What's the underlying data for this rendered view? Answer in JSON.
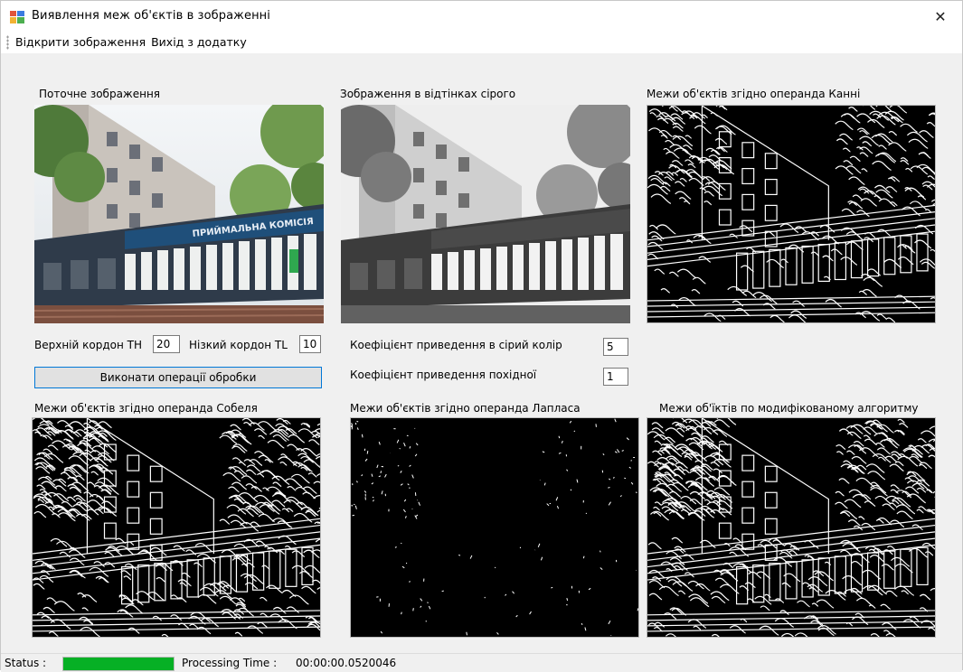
{
  "window": {
    "title": "Виявлення меж об'єктів в зображенні",
    "close_symbol": "✕"
  },
  "menu": {
    "items": [
      "Відкрити зображення",
      "Вихід з додатку"
    ]
  },
  "panels": {
    "current_label": "Поточне зображення",
    "gray_label": "Зображення в відтінках сірого",
    "canny_label": "Межи об'єктів згідно операнда Канні",
    "sobel_label": "Межи об'єктів згідно операнда Собеля",
    "laplace_label": "Межи об'єктів згідно операнда Лапласа",
    "modified_label": "Межи об'їктів по модифікованому алгоритму"
  },
  "photo_sign": "ПРИЙМАЛЬНА КОМІСІЯ",
  "params": {
    "th_label": "Верхній кордон TH",
    "th_value": "20",
    "tl_label": "Нізкий кордон TL",
    "tl_value": "10",
    "gray_coef_label": "Коефіцієнт приведення в сірий колір",
    "gray_coef_value": "5",
    "deriv_coef_label": "Коефіцієнт приведення  похідної",
    "deriv_coef_value": "1",
    "run_button": "Виконати операції обробки"
  },
  "status": {
    "label": "Status :",
    "progress": 1.0,
    "time_label": "Processing Time :",
    "time_value": "00:00:00.0520046"
  },
  "colors": {
    "progress_green": "#06b025",
    "button_border": "#0078d7"
  },
  "icons": {
    "app": "app-window-icon",
    "close": "close-icon"
  }
}
